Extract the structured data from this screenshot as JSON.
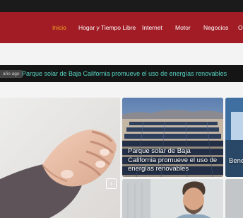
{
  "nav": {
    "items": [
      {
        "label": "Inicio",
        "active": true
      },
      {
        "label": "Hogar y Tiempo Libre",
        "active": false
      },
      {
        "label": "Internet",
        "active": false
      },
      {
        "label": "Motor",
        "active": false
      },
      {
        "label": "Negocios",
        "active": false
      },
      {
        "label": "O",
        "active": false
      }
    ]
  },
  "ticker": {
    "badge": "año ago",
    "headline": "Parque solar de Baja California promueve el uso de energías renovables"
  },
  "cards": {
    "solar_title": "Parque solar de Baja California promueve el uso de energías renovables",
    "right_title": "Bene inye"
  },
  "colors": {
    "nav_bg": "#a11c25",
    "nav_active": "#f5a623",
    "ticker_text": "#58d4c2",
    "topbar": "#1b1b1b"
  },
  "icons": {
    "next": "chevron-right-icon"
  }
}
